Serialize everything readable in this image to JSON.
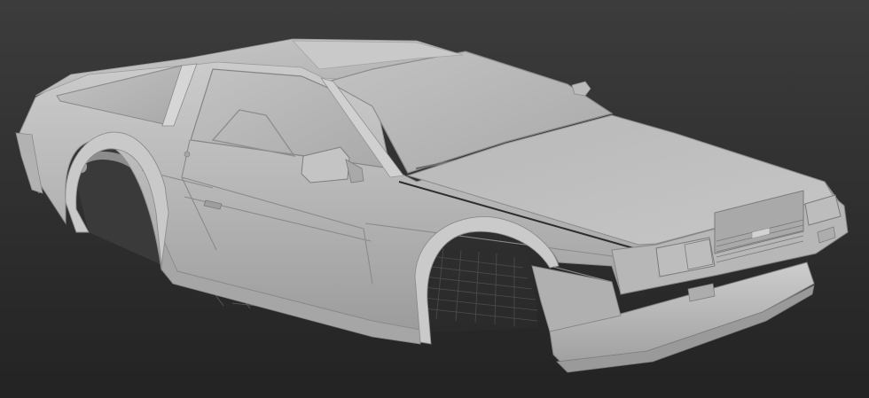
{
  "viewport": {
    "view": "perspective",
    "shading": "default-shading",
    "background_top": "#3a3a3a",
    "background_bottom": "#262626",
    "grid_visible": true,
    "grid_color": "#5a5a5a"
  },
  "model": {
    "name": "",
    "subject": "sports-car-body-shell",
    "material_base": "#b9b9b9",
    "material_light": "#d3d3d3",
    "material_dark": "#8a8a8a",
    "material_deep": "#5e5e5e"
  }
}
